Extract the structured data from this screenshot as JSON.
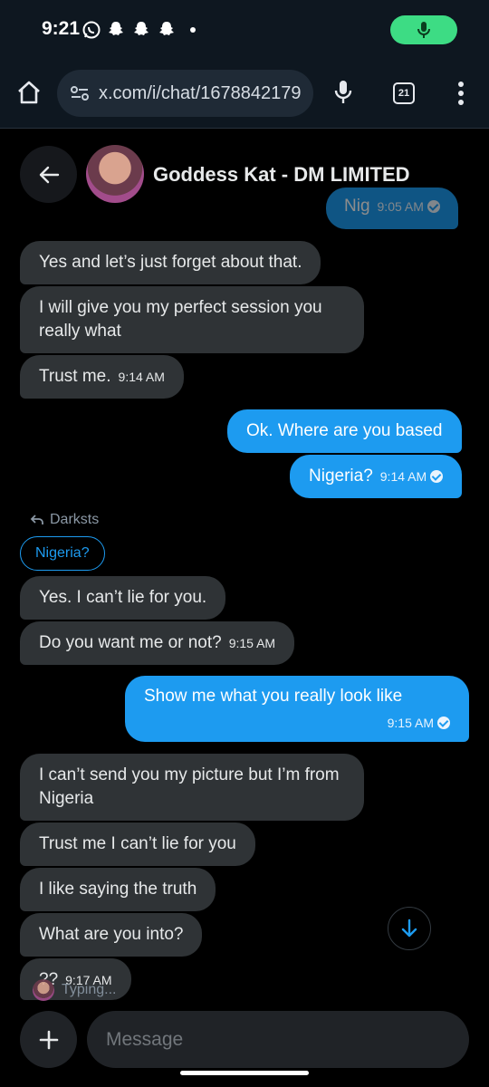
{
  "status_bar": {
    "time": "9:21"
  },
  "browser": {
    "url": "x.com/i/chat/1678842179",
    "tab_count": "21"
  },
  "chat": {
    "title": "Goddess Kat - DM LIMITED",
    "messages": [
      {
        "text": "Nig",
        "time": "9:05 AM"
      },
      {
        "text": "Yes and let’s just forget about that."
      },
      {
        "text": "I will give you my perfect session you really what"
      },
      {
        "text": "Trust me.",
        "time": "9:14 AM"
      },
      {
        "text": "Ok. Where are you based"
      },
      {
        "text": "Nigeria?",
        "time": "9:14 AM"
      },
      {
        "text": "Yes. I can’t lie for you."
      },
      {
        "text": "Do you want me or not?",
        "time": "9:15 AM"
      },
      {
        "text": "Show me what you really look like",
        "time": "9:15 AM"
      },
      {
        "text": "I can’t send you my picture but I’m from Nigeria"
      },
      {
        "text": "Trust me I can’t lie for you"
      },
      {
        "text": "I like saying the truth"
      },
      {
        "text": "What are you into?"
      },
      {
        "text": "??",
        "time": "9:17 AM"
      }
    ],
    "reply_hint": "Darksts",
    "quoted": "Nigeria?",
    "typing": "Typing..."
  },
  "composer": {
    "placeholder": "Message"
  },
  "colors": {
    "accent": "#1d9bf0",
    "incoming": "#2f3336",
    "background": "#000000"
  }
}
